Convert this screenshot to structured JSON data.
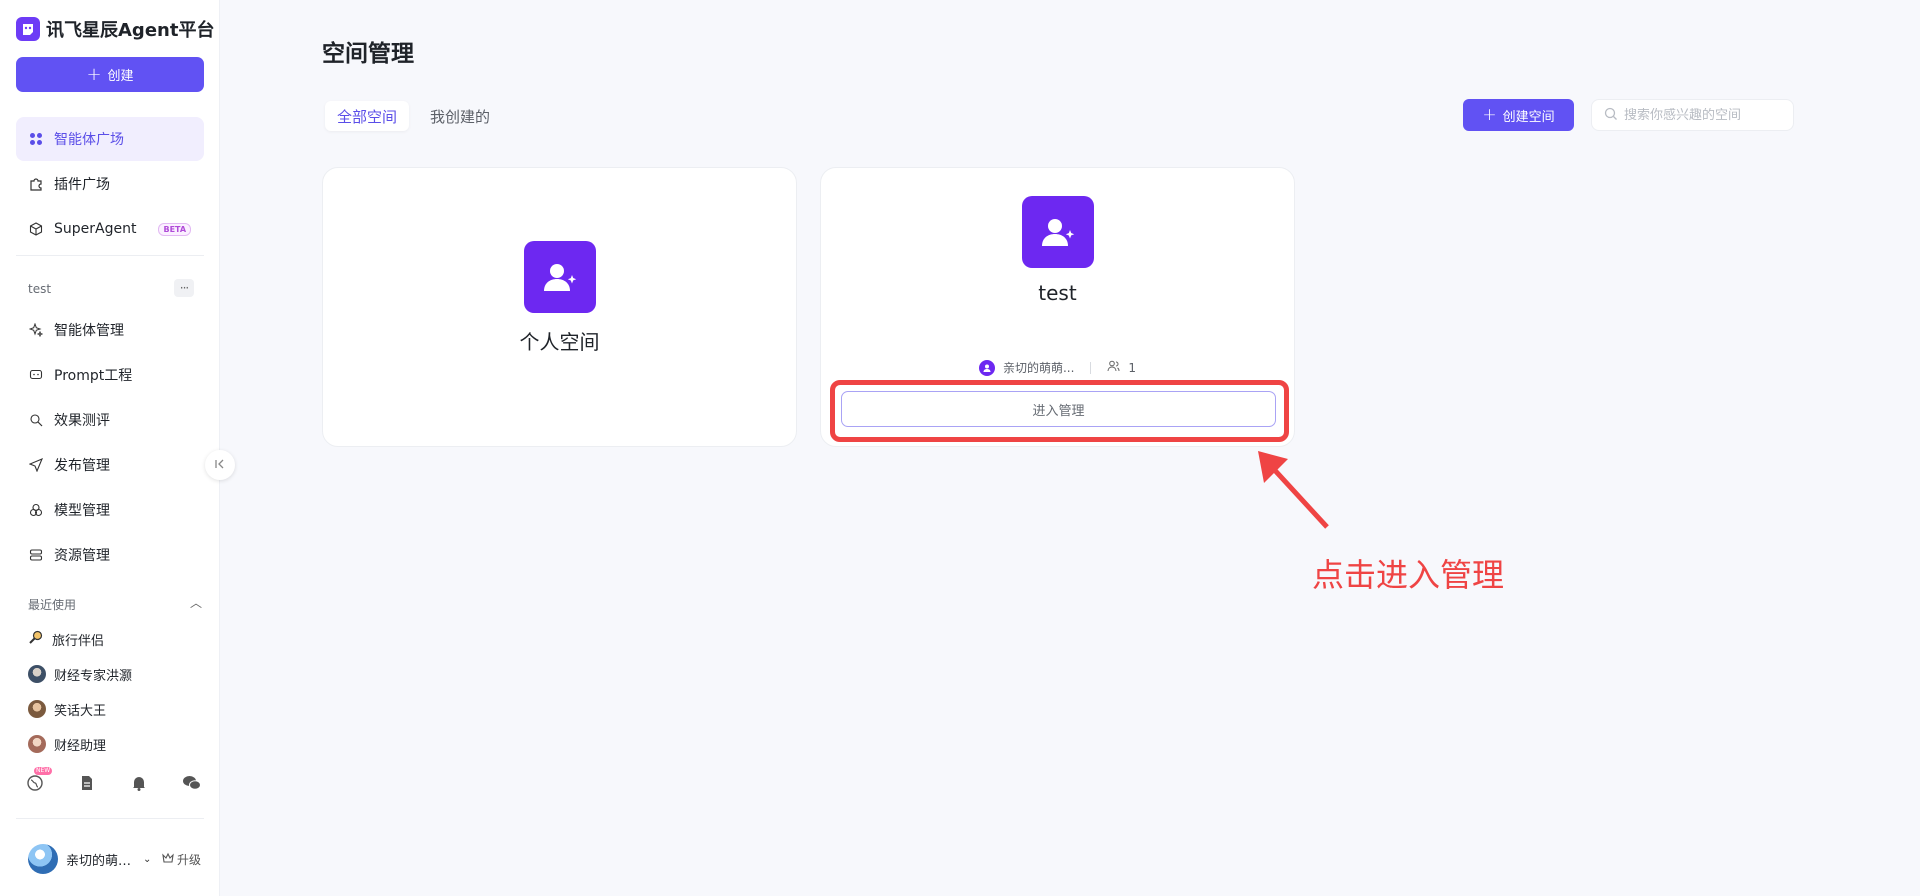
{
  "sidebar": {
    "brand": "讯飞星辰Agent平台",
    "create_label": "创建",
    "nav": [
      {
        "label": "智能体广场",
        "icon": "grid-icon",
        "active": true
      },
      {
        "label": "插件广场",
        "icon": "puzzle-icon"
      },
      {
        "label": "SuperAgent",
        "icon": "cube-icon",
        "badge": "BETA"
      }
    ],
    "workspace": {
      "name": "test",
      "more": "···",
      "items": [
        {
          "label": "智能体管理",
          "icon": "sparkle-icon"
        },
        {
          "label": "Prompt工程",
          "icon": "prompt-icon"
        },
        {
          "label": "效果测评",
          "icon": "evaluate-icon"
        },
        {
          "label": "发布管理",
          "icon": "send-icon"
        },
        {
          "label": "模型管理",
          "icon": "model-icon"
        },
        {
          "label": "资源管理",
          "icon": "resource-icon"
        }
      ]
    },
    "recent": {
      "title": "最近使用",
      "items": [
        {
          "label": "旅行伴侣",
          "icon": "magnifier-icon"
        },
        {
          "label": "财经专家洪灏",
          "icon": "avatar"
        },
        {
          "label": "笑话大王",
          "icon": "avatar"
        },
        {
          "label": "财经助理",
          "icon": "avatar"
        }
      ]
    },
    "bottom_icons": [
      "globe-icon",
      "document-icon",
      "bell-icon",
      "wechat-icon"
    ],
    "new_tag": "NEW",
    "user": {
      "name": "亲切的萌…",
      "upgrade": "升级"
    }
  },
  "main": {
    "title": "空间管理",
    "tabs": [
      {
        "label": "全部空间",
        "active": true
      },
      {
        "label": "我创建的",
        "active": false
      }
    ],
    "create_space_label": "创建空间",
    "search_placeholder": "搜索你感兴趣的空间",
    "cards": [
      {
        "name": "个人空间"
      },
      {
        "name": "test",
        "owner": "亲切的萌萌...",
        "members": "1",
        "action": "进入管理"
      }
    ]
  },
  "annotation": {
    "text": "点击进入管理"
  },
  "colors": {
    "accent": "#6152f3",
    "icon_bg": "#6d28f1",
    "highlight": "#ef4444"
  }
}
